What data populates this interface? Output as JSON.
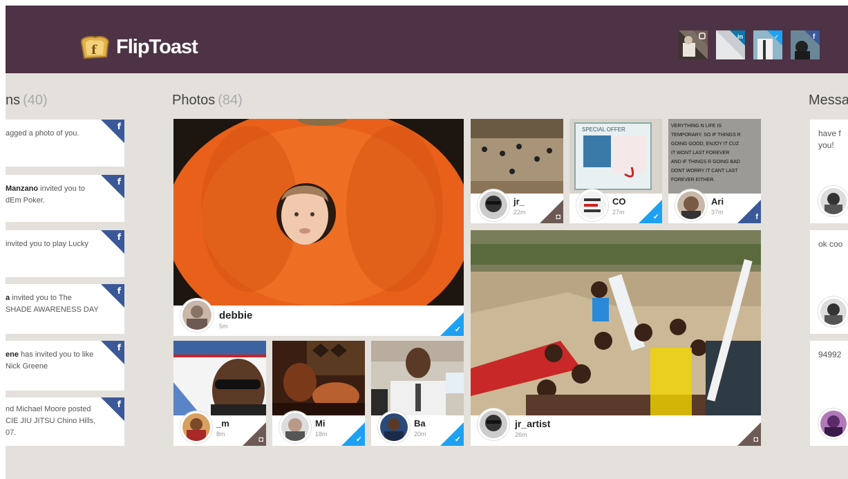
{
  "app": {
    "name": "FlipToast",
    "accent": "#4d3345",
    "bg": "#e4e1dc"
  },
  "header": {
    "logo_text": "FlipToast",
    "accounts": [
      {
        "network": "instagram",
        "icon": "instagram-icon"
      },
      {
        "network": "linkedin",
        "icon": "linkedin-icon"
      },
      {
        "network": "twitter",
        "icon": "twitter-icon"
      },
      {
        "network": "facebook",
        "icon": "facebook-icon"
      }
    ]
  },
  "notifications": {
    "title": "ns",
    "count": "(40)",
    "items": [
      {
        "pre": "",
        "bold": "",
        "text": "agged a photo of you.",
        "network": "facebook"
      },
      {
        "pre": "",
        "bold": "Manzano",
        "text": " invited you to",
        "line2": "dEm Poker.",
        "network": "facebook"
      },
      {
        "pre": "",
        "bold": "",
        "text": " invited you to play Lucky",
        "network": "facebook"
      },
      {
        "pre": "",
        "bold": "a",
        "text": " invited you to The",
        "line2": "SHADE AWARENESS DAY",
        "network": "facebook"
      },
      {
        "pre": "",
        "bold": "ene",
        "text": " has invited you to like",
        "line2": "Nick Greene",
        "network": "facebook"
      },
      {
        "pre": "",
        "bold": "",
        "text": "nd Michael Moore posted",
        "line2": "CIE JIU JITSU Chino Hills,",
        "line3": "07.",
        "network": "facebook"
      }
    ]
  },
  "photos": {
    "title": "Photos",
    "count": "(84)",
    "tiles": [
      {
        "user": "debbie",
        "time": "5m",
        "network": "twitter"
      },
      {
        "user": "jr_",
        "time": "22m",
        "network": "instagram"
      },
      {
        "user": "CO",
        "time": "27m",
        "network": "twitter"
      },
      {
        "user": "Ari",
        "time": "37m",
        "network": "facebook"
      },
      {
        "user": "_m",
        "time": "8m",
        "network": "instagram"
      },
      {
        "user": "Mi",
        "time": "18m",
        "network": "twitter"
      },
      {
        "user": "Ba",
        "time": "20m",
        "network": "twitter"
      },
      {
        "user": "jr_artist",
        "time": "26m",
        "network": "instagram"
      }
    ],
    "sign_text": "VERYTHING N LIFE IS\nTEMPORARY. SO IF THINGS R\nGOING GOOD, ENJOY IT CUZ\nIT WONT LAST FOREVER\nAND IF THINGS R GOING BAD\nDONT WORRY IT CANT LAST\nFOREVER EITHER.",
    "poster_text": "SPECIAL OFFER"
  },
  "messages": {
    "title": "Messa",
    "items": [
      {
        "text": "have f",
        "line2": "you!"
      },
      {
        "text": "ok coo"
      },
      {
        "text": "94992"
      }
    ]
  }
}
